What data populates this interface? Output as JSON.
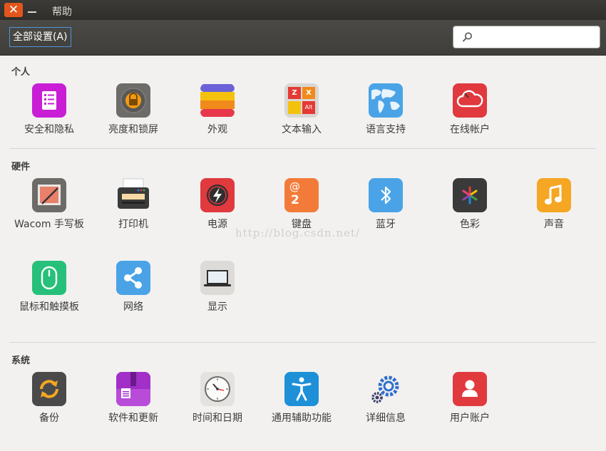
{
  "window": {
    "menu_help": "帮助",
    "close_glyph": "✕"
  },
  "toolbar": {
    "all_settings_label": "全部设置(A)",
    "search_value": "",
    "search_placeholder": ""
  },
  "watermark": "http://blog.csdn.net/",
  "sections": {
    "personal": {
      "title": "个人",
      "items": [
        {
          "label": "安全和隐私",
          "icon": "security-privacy-icon"
        },
        {
          "label": "亮度和锁屏",
          "icon": "brightness-lock-icon"
        },
        {
          "label": "外观",
          "icon": "appearance-icon"
        },
        {
          "label": "文本输入",
          "icon": "text-entry-icon"
        },
        {
          "label": "语言支持",
          "icon": "language-support-icon"
        },
        {
          "label": "在线帐户",
          "icon": "online-accounts-icon"
        }
      ]
    },
    "hardware": {
      "title": "硬件",
      "items": [
        {
          "label": "Wacom 手写板",
          "icon": "wacom-tablet-icon"
        },
        {
          "label": "打印机",
          "icon": "printer-icon"
        },
        {
          "label": "电源",
          "icon": "power-icon"
        },
        {
          "label": "键盘",
          "icon": "keyboard-icon"
        },
        {
          "label": "蓝牙",
          "icon": "bluetooth-icon"
        },
        {
          "label": "色彩",
          "icon": "color-icon"
        },
        {
          "label": "声音",
          "icon": "sound-icon"
        },
        {
          "label": "鼠标和触摸板",
          "icon": "mouse-touchpad-icon"
        },
        {
          "label": "网络",
          "icon": "network-icon"
        },
        {
          "label": "显示",
          "icon": "display-icon"
        }
      ]
    },
    "system": {
      "title": "系统",
      "items": [
        {
          "label": "备份",
          "icon": "backup-icon"
        },
        {
          "label": "软件和更新",
          "icon": "software-updates-icon"
        },
        {
          "label": "时间和日期",
          "icon": "time-date-icon"
        },
        {
          "label": "通用辅助功能",
          "icon": "universal-access-icon"
        },
        {
          "label": "详细信息",
          "icon": "details-icon"
        },
        {
          "label": "用户账户",
          "icon": "user-accounts-icon"
        }
      ]
    }
  },
  "icon_glyphs": {
    "keyboard_at": "@",
    "keyboard_num": "2",
    "text_z": "Z",
    "text_x": "X",
    "text_alt": "Alt"
  }
}
